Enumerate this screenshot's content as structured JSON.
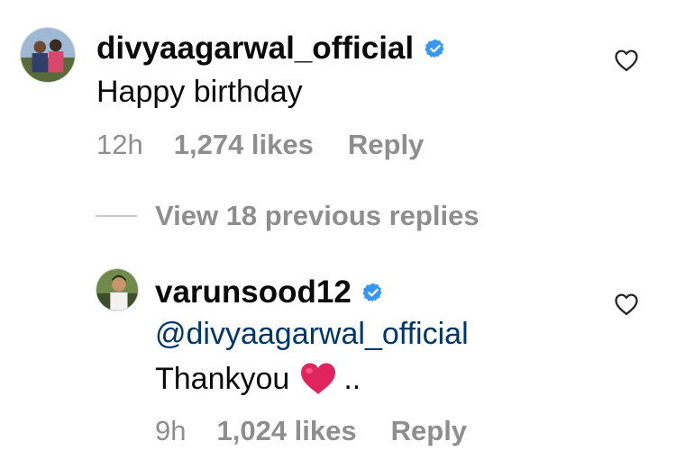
{
  "comment": {
    "username": "divyaagarwal_official",
    "text": "Happy birthday",
    "time": "12h",
    "likes": "1,274 likes",
    "reply_label": "Reply",
    "verified_icon": "verified-badge-icon",
    "like_icon": "heart-outline-icon"
  },
  "replies_toggle": {
    "label": "View 18 previous replies"
  },
  "reply": {
    "username": "varunsood12",
    "mention": "@divyaagarwal_official",
    "text": "Thankyou",
    "emoji": "red-heart-emoji",
    "trailing": "..",
    "time": "9h",
    "likes": "1,024 likes",
    "reply_label": "Reply",
    "verified_icon": "verified-badge-icon",
    "like_icon": "heart-outline-icon"
  },
  "colors": {
    "verified": "#3897f0",
    "mention": "#00376b",
    "meta": "#8e8e8e",
    "heart_emoji": "#e0245e"
  }
}
